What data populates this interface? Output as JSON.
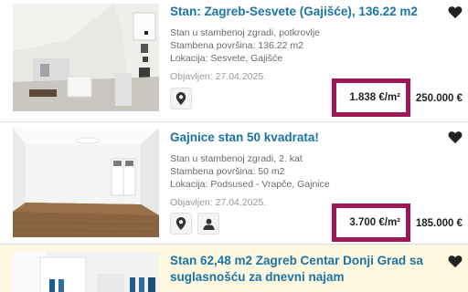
{
  "listings": [
    {
      "title": "Stan: Zagreb-Sesvete (Gajišće), 136.22 m2",
      "details": [
        "Stan u stambenoj zgradi, potkrovlje",
        "Stambena površina: 136.22 m2",
        "Lokacija: Sesvete, Gajišće"
      ],
      "published": "Objavljen: 27.04.2025.",
      "price_per_m2": "1.838 €/m²",
      "price": "250.000 €",
      "actions": [
        "map-pin-icon"
      ]
    },
    {
      "title": "Gajnice stan 50 kvadrata!",
      "details": [
        "Stan u stambenoj zgradi, 2. kat",
        "Stambena površina: 50 m2",
        "Lokacija: Podsused - Vrapče, Gajnice"
      ],
      "published": "Objavljen: 27.04.2025.",
      "price_per_m2": "3.700 €/m²",
      "price": "185.000 €",
      "actions": [
        "map-pin-icon",
        "person-icon"
      ]
    },
    {
      "title": "Stan 62,48 m2 Zagreb Centar Donji Grad sa suglasnošću za dnevni najam"
    }
  ],
  "colors": {
    "title": "#1b73a6",
    "highlight_border": "#a01758",
    "featured_bg": "#fdf8df"
  }
}
